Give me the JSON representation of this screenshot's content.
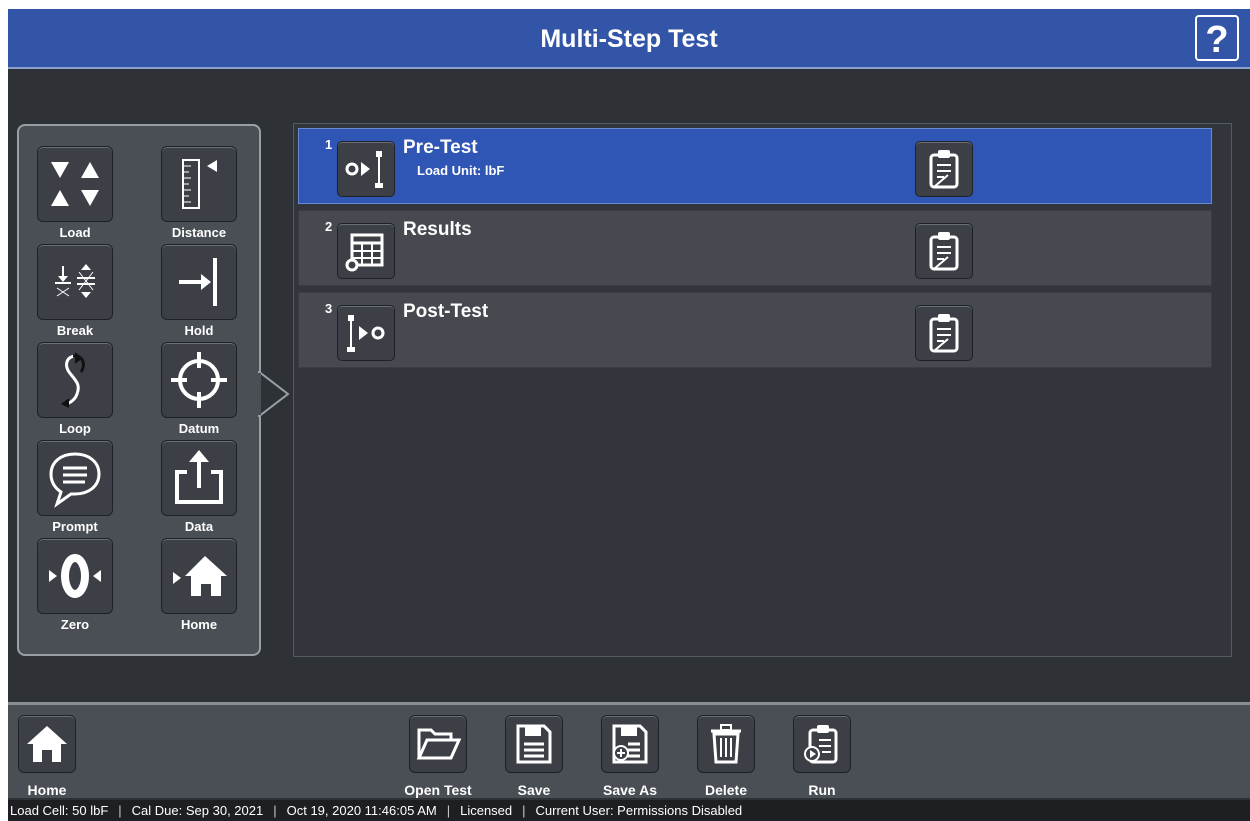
{
  "header": {
    "title": "Multi-Step Test",
    "help_label": "?"
  },
  "palette": {
    "items": [
      {
        "label": "Load",
        "icon": "load-icon"
      },
      {
        "label": "Distance",
        "icon": "distance-icon"
      },
      {
        "label": "Break",
        "icon": "break-icon"
      },
      {
        "label": "Hold",
        "icon": "hold-icon"
      },
      {
        "label": "Loop",
        "icon": "loop-icon"
      },
      {
        "label": "Datum",
        "icon": "datum-icon"
      },
      {
        "label": "Prompt",
        "icon": "prompt-icon"
      },
      {
        "label": "Data",
        "icon": "data-export-icon"
      },
      {
        "label": "Zero",
        "icon": "zero-icon"
      },
      {
        "label": "Home",
        "icon": "home-icon"
      }
    ]
  },
  "steps": [
    {
      "number": "1",
      "name": "Pre-Test",
      "subtitle": "Load Unit: lbF",
      "selected": true,
      "icon": "pre-test-icon"
    },
    {
      "number": "2",
      "name": "Results",
      "subtitle": "",
      "selected": false,
      "icon": "results-table-icon"
    },
    {
      "number": "3",
      "name": "Post-Test",
      "subtitle": "",
      "selected": false,
      "icon": "post-test-icon"
    }
  ],
  "toolbar": {
    "home_label": "Home",
    "open_label": "Open Test",
    "save_label": "Save",
    "save_as_label": "Save As",
    "delete_label": "Delete",
    "run_label": "Run"
  },
  "status": {
    "load_cell": "Load Cell: 50 lbF",
    "cal_due": "Cal Due: Sep 30, 2021",
    "datetime": "Oct 19, 2020 11:46:05 AM",
    "license": "Licensed",
    "user": "Current User: Permissions Disabled",
    "separator": "|"
  },
  "colors": {
    "header": "#3355a8",
    "selected_step": "#2f55b5",
    "background": "#2e3237"
  }
}
